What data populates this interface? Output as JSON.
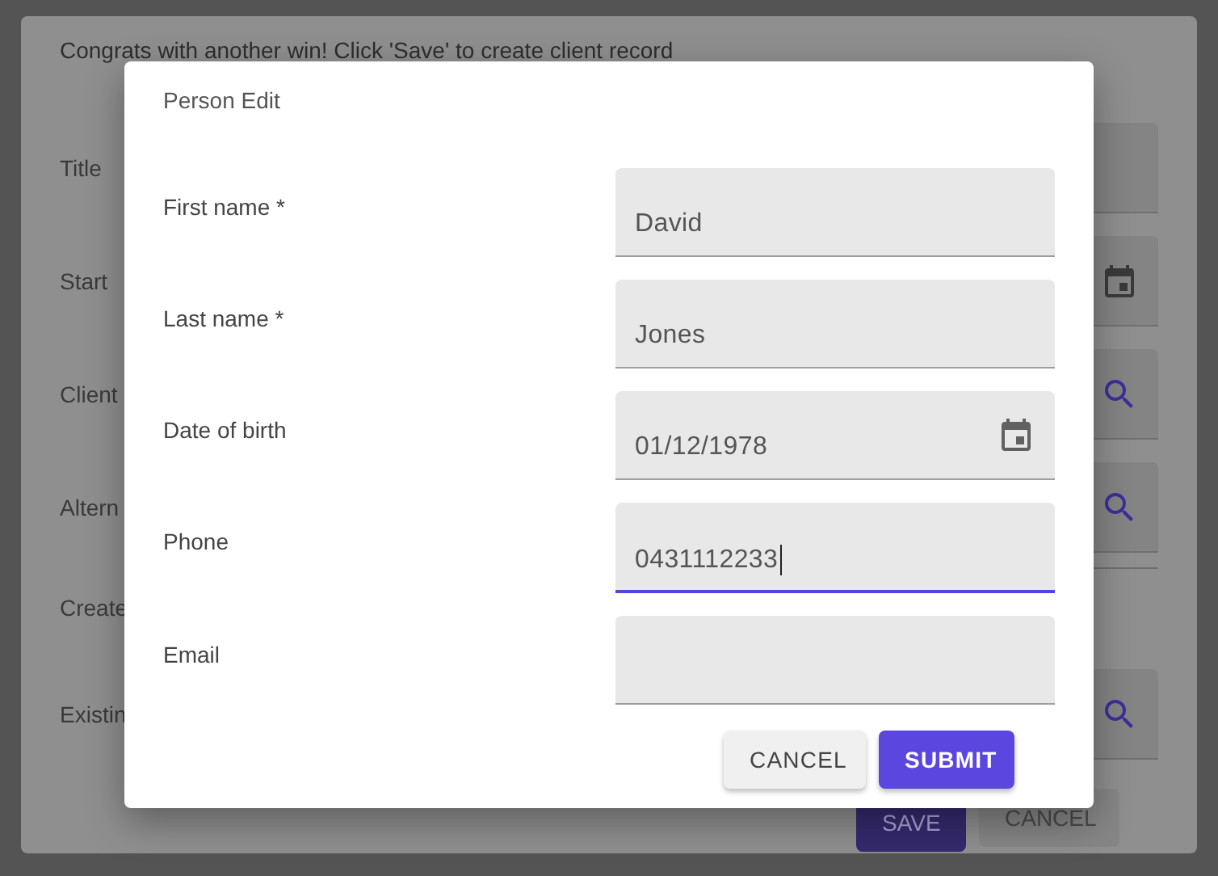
{
  "background_form": {
    "message": "Congrats with another win! Click 'Save' to create client record",
    "rows": [
      {
        "label": "Title",
        "kind": "text"
      },
      {
        "label": "Start",
        "kind": "date"
      },
      {
        "label": "Client",
        "kind": "search"
      },
      {
        "label": "Altern",
        "kind": "search"
      },
      {
        "label": "Create",
        "kind": "divider"
      },
      {
        "label": "Existin",
        "kind": "search"
      }
    ],
    "buttons": [
      {
        "label": "SAVE",
        "kind": "primary"
      },
      {
        "label": "CANCEL",
        "kind": "secondary"
      }
    ]
  },
  "dialog": {
    "title": "Person Edit",
    "fields": [
      {
        "label": "First name *",
        "value": "David",
        "kind": "text",
        "focused": false
      },
      {
        "label": "Last name *",
        "value": "Jones",
        "kind": "text",
        "focused": false
      },
      {
        "label": "Date of birth",
        "value": "01/12/1978",
        "kind": "date",
        "focused": false
      },
      {
        "label": "Phone",
        "value": "0431112233",
        "kind": "text",
        "focused": true
      },
      {
        "label": "Email",
        "kind": "text",
        "focused": false
      }
    ],
    "buttons": [
      {
        "label": "CANCEL",
        "kind": "secondary"
      },
      {
        "label": "SUBMIT",
        "kind": "primary"
      }
    ]
  }
}
